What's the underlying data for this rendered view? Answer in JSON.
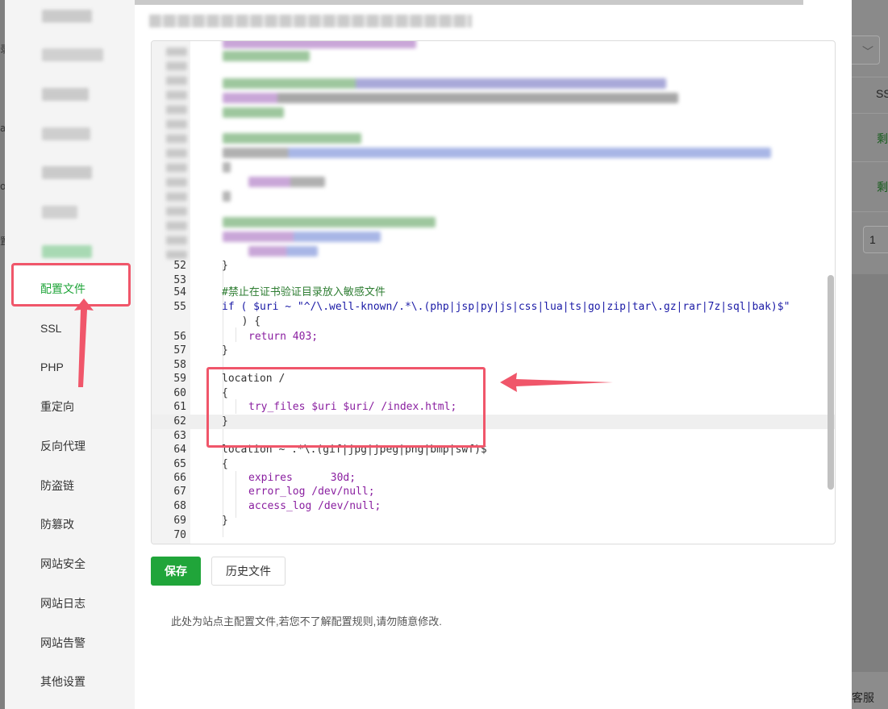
{
  "background": {
    "right_labels": [
      "SS",
      "剩",
      "剩",
      "1"
    ],
    "bottom_label": "客服",
    "left_labels": [
      "录",
      "al",
      "o",
      "置"
    ]
  },
  "sidebar": {
    "items": [
      {
        "label": "配置文件",
        "active": true
      },
      {
        "label": "SSL"
      },
      {
        "label": "PHP"
      },
      {
        "label": "重定向"
      },
      {
        "label": "反向代理"
      },
      {
        "label": "防盗链"
      },
      {
        "label": "防篡改"
      },
      {
        "label": "网站安全"
      },
      {
        "label": "网站日志"
      },
      {
        "label": "网站告警"
      },
      {
        "label": "其他设置"
      }
    ]
  },
  "editor": {
    "lines": [
      {
        "n": "52",
        "text": "}"
      },
      {
        "n": "53",
        "text": ""
      },
      {
        "n": "54",
        "text": "#禁止在证书验证目录放入敏感文件"
      },
      {
        "n": "55",
        "text": "if ( $uri ~ \"^/\\.well-known/.*\\.(php|jsp|py|js|css|lua|ts|go|zip|tar\\.gz|rar|7z|sql|bak)$\""
      },
      {
        "n": "",
        "text": "  ) {"
      },
      {
        "n": "56",
        "text": "return 403;"
      },
      {
        "n": "57",
        "text": "}"
      },
      {
        "n": "58",
        "text": ""
      },
      {
        "n": "59",
        "text": "location /"
      },
      {
        "n": "60",
        "text": "{"
      },
      {
        "n": "61",
        "text": "try_files $uri $uri/ /index.html;"
      },
      {
        "n": "62",
        "text": "}"
      },
      {
        "n": "63",
        "text": ""
      },
      {
        "n": "64",
        "text": "location ~ .*\\.(gif|jpg|jpeg|png|bmp|swf)$"
      },
      {
        "n": "65",
        "text": "{"
      },
      {
        "n": "66",
        "text": "expires      30d;"
      },
      {
        "n": "67",
        "text": "error_log /dev/null;"
      },
      {
        "n": "68",
        "text": "access_log /dev/null;"
      },
      {
        "n": "69",
        "text": "}"
      },
      {
        "n": "70",
        "text": ""
      }
    ]
  },
  "buttons": {
    "save": "保存",
    "history": "历史文件"
  },
  "note": "此处为站点主配置文件,若您不了解配置规则,请勿随意修改.",
  "colors": {
    "accent": "#20a53a",
    "annotation": "#f0566a"
  }
}
